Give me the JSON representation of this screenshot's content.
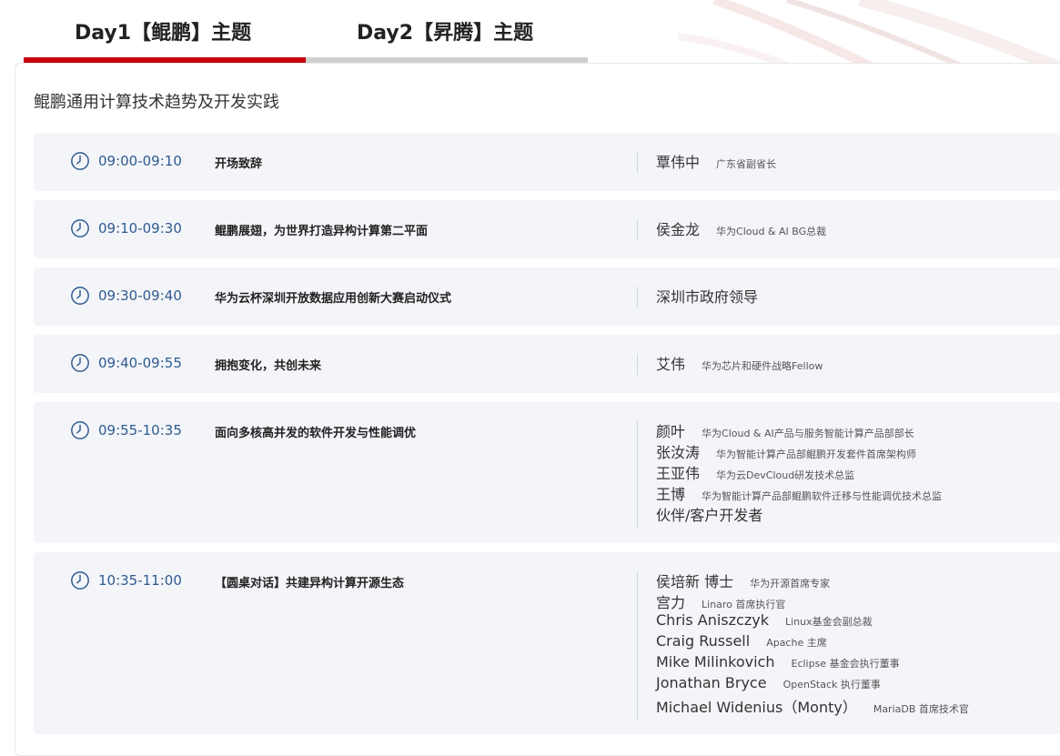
{
  "tabs": [
    {
      "label": "Day1【鲲鹏】主题",
      "active": true
    },
    {
      "label": "Day2【昇腾】主题",
      "active": false
    }
  ],
  "section_title": "鲲鹏通用计算技术趋势及开发实践",
  "colors": {
    "accent": "#c7000b",
    "time": "#2f5a8f",
    "row_bg": "#f3f5f9"
  },
  "icons": {
    "time": "clock-icon"
  },
  "sessions": [
    {
      "time": "09:00-09:10",
      "topic": "开场致辞",
      "speakers": [
        {
          "name": "覃伟中",
          "title": "广东省副省长"
        }
      ]
    },
    {
      "time": "09:10-09:30",
      "topic": "鲲鹏展翅，为世界打造异构计算第二平面",
      "speakers": [
        {
          "name": "侯金龙",
          "title": "华为Cloud & AI BG总裁"
        }
      ]
    },
    {
      "time": "09:30-09:40",
      "topic": "华为云杯深圳开放数据应用创新大赛启动仪式",
      "speakers": [
        {
          "name": "深圳市政府领导",
          "title": ""
        }
      ]
    },
    {
      "time": "09:40-09:55",
      "topic": "拥抱变化，共创未来",
      "speakers": [
        {
          "name": "艾伟",
          "title": "华为芯片和硬件战略Fellow"
        }
      ]
    },
    {
      "time": "09:55-10:35",
      "topic": "面向多核高并发的软件开发与性能调优",
      "speakers": [
        {
          "name": "颜叶",
          "title": "华为Cloud & AI产品与服务智能计算产品部部长"
        },
        {
          "name": "张汝涛",
          "title": "华为智能计算产品部鲲鹏开发套件首席架构师"
        },
        {
          "name": "王亚伟",
          "title": "华为云DevCloud研发技术总监"
        },
        {
          "name": "王博",
          "title": "华为智能计算产品部鲲鹏软件迁移与性能调优技术总监"
        },
        {
          "name": "伙伴/客户开发者",
          "title": ""
        }
      ]
    },
    {
      "time": "10:35-11:00",
      "topic": "【圆桌对话】共建异构计算开源生态",
      "speakers": [
        {
          "name": "侯培新 博士",
          "title": "华为开源首席专家"
        },
        {
          "name": "宫力",
          "title": "Linaro 首席执行官"
        },
        {
          "name": "Chris Aniszczyk",
          "title": "Linux基金会副总裁"
        },
        {
          "name": "Craig Russell",
          "title": "Apache 主席"
        },
        {
          "name": "Mike Milinkovich",
          "title": "Eclipse 基金会执行董事"
        },
        {
          "name": "Jonathan Bryce",
          "title": "OpenStack 执行董事"
        },
        {
          "name": "Michael Widenius（Monty）",
          "title": "MariaDB 首席技术官"
        }
      ]
    }
  ]
}
